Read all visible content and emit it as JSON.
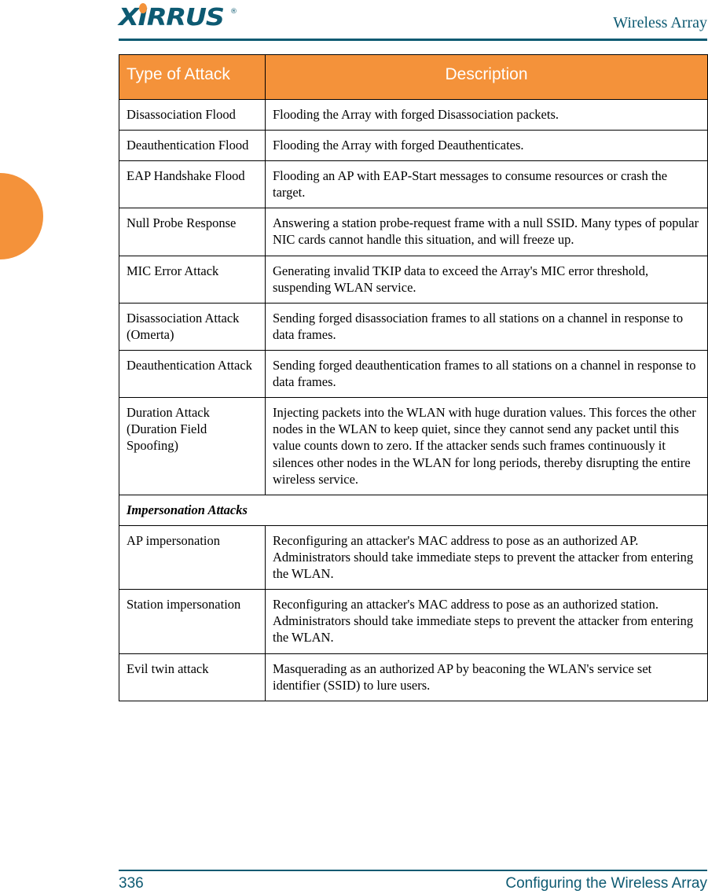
{
  "page": {
    "brand_logo_text": "XIRRUS",
    "brand_logo_registered": "®",
    "header_title": "Wireless Array",
    "accent_orange": "#f4923a",
    "accent_teal": "#0d5a72",
    "left_tab_icon": "orange-semicircle-tab"
  },
  "table": {
    "columns": [
      "Type of Attack",
      "Description"
    ],
    "rows": [
      {
        "kind": "data",
        "type": "Disassociation Flood",
        "description": "Flooding the Array with forged Disassociation packets."
      },
      {
        "kind": "data",
        "type": "Deauthentication Flood",
        "description": "Flooding the Array with forged Deauthenticates."
      },
      {
        "kind": "data",
        "type": "EAP Handshake Flood",
        "description": "Flooding an AP with EAP-Start messages to consume resources or crash the target."
      },
      {
        "kind": "data",
        "type": "Null Probe Response",
        "description": "Answering a station probe-request frame with a null SSID. Many types of popular NIC cards cannot handle this situation, and will freeze up."
      },
      {
        "kind": "data",
        "type": "MIC Error Attack",
        "description": "Generating invalid TKIP data to exceed the Array's MIC error threshold, suspending WLAN service."
      },
      {
        "kind": "data",
        "type": "Disassociation Attack (Omerta)",
        "description": "Sending forged disassociation frames to all stations on a channel in response to data frames."
      },
      {
        "kind": "data",
        "type": "Deauthentication Attack",
        "description": "Sending forged deauthentication frames to all stations on a channel in response to data frames."
      },
      {
        "kind": "data",
        "type": "Duration Attack (Duration Field Spoofing)",
        "description": "Injecting packets into the WLAN with huge duration values. This forces the other nodes in the WLAN to keep quiet, since they cannot send any packet until this value counts down to zero. If the attacker sends such frames continuously it silences other nodes in the WLAN for long periods, thereby disrupting the entire wireless service."
      },
      {
        "kind": "section",
        "label": "Impersonation Attacks"
      },
      {
        "kind": "data",
        "type": "AP impersonation",
        "description": "Reconfiguring an attacker's MAC address to pose as an authorized AP. Administrators should take immediate steps to prevent the attacker from entering the WLAN."
      },
      {
        "kind": "data",
        "type": "Station impersonation",
        "description": "Reconfiguring an attacker's MAC address to pose as an authorized station. Administrators should take immediate steps to prevent the attacker from entering the WLAN."
      },
      {
        "kind": "data",
        "type": "Evil twin attack",
        "description": "Masquerading as an authorized AP by beaconing the WLAN's service set identifier (SSID) to lure users."
      }
    ]
  },
  "footer": {
    "page_number": "336",
    "section_title": "Configuring the Wireless Array"
  }
}
